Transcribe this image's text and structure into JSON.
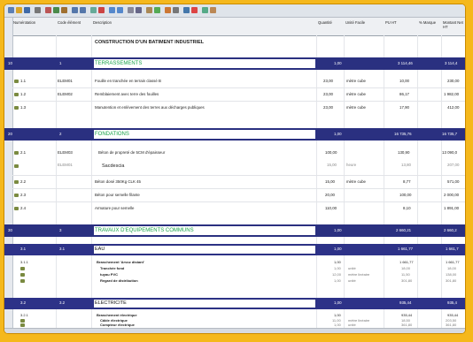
{
  "header": {
    "col_numerotation": "Numérotation",
    "col_code": "Code élément",
    "col_description": "Description",
    "col_quantite": "Quantité",
    "col_unite": "Unité Facile",
    "col_pu": "PU HT",
    "col_pct": "% Marque",
    "col_montant": "Montant Net HT"
  },
  "title_row": {
    "text": "CONSTRUCTION D'UN BATIMENT INDUSTRIEL"
  },
  "sections": [
    {
      "num": "10",
      "code": "1",
      "title": "TERRASSEMENTS",
      "qty": "1,00",
      "pu": "3 114,46",
      "montant": "3 114,4"
    },
    {
      "num": "20",
      "code": "2",
      "title": "FONDATIONS",
      "qty": "1,00",
      "pu": "16 735,76",
      "montant": "16 735,7"
    },
    {
      "num": "30",
      "code": "3",
      "title": "TRAVAUX D'EQUIPEMENTS COMMUNS",
      "qty": "1,00",
      "pu": "2 660,21",
      "montant": "2 660,2"
    }
  ],
  "items_terrassements": [
    {
      "num": "1.1",
      "code": "ELEM01",
      "desc": "Fouille en tranchée en terrain classé B",
      "qty": "23,00",
      "unit": "mètre cube",
      "pu": "10,00",
      "montant": "230,00"
    },
    {
      "num": "1.2",
      "code": "ELEM02",
      "desc": "Remblaiement avec terre des fouilles",
      "qty": "23,00",
      "unit": "mètre cube",
      "pu": "86,17",
      "montant": "1 982,00"
    },
    {
      "num": "1.3",
      "code": "",
      "desc": "Manutention et enlèvement des terres aux décharges publiques",
      "qty": "23,00",
      "unit": "mètre cube",
      "pu": "17,90",
      "montant": "412,00"
    }
  ],
  "items_fondations": [
    {
      "num": "2.1",
      "code": "ELEM03",
      "desc": "Béton de propreté de 5CM d'épaisseur",
      "qty": "100,00",
      "unit": "",
      "pu": "130,90",
      "montant": "13 090,0"
    },
    {
      "num": "",
      "code": "ELEM01",
      "desc": "Sacdescia",
      "qty": "15,00",
      "unit": "heure",
      "pu": "13,80",
      "montant": "207,00"
    },
    {
      "num": "2.2",
      "code": "",
      "desc": "Béton dosé 350Kg CLK 45",
      "qty": "15,00",
      "unit": "mètre cube",
      "pu": "8,77",
      "montant": "571,00"
    },
    {
      "num": "2.3",
      "code": "",
      "desc": "Béton pour semelle filante",
      "qty": "20,00",
      "unit": "",
      "pu": "100,00",
      "montant": "2 000,00"
    },
    {
      "num": "2.4",
      "code": "",
      "desc": "Armature pour semelle",
      "qty": "110,00",
      "unit": "",
      "pu": "8,10",
      "montant": "1 891,00"
    }
  ],
  "sub_eau": {
    "num": "3.1",
    "code": "3.1",
    "title": "EAU",
    "qty": "1,00",
    "pu": "1 661,77",
    "montant": "1 661,7"
  },
  "items_eau": [
    {
      "num": "3.1.1",
      "desc": "Branchement 'Arvoz distant'",
      "qty": "1,00",
      "unit": "",
      "pu": "1 661,77",
      "montant": "1 661,77"
    },
    {
      "num": "",
      "desc": "Tranchée fond",
      "qty": "1,00",
      "unit": "unité",
      "pu": "18,00",
      "montant": "18,00"
    },
    {
      "num": "",
      "desc": "tuyau PVC",
      "qty": "12,00",
      "unit": "mètre linéaire",
      "pu": "11,50",
      "montant": "138,00"
    },
    {
      "num": "",
      "desc": "Regard de distribution",
      "qty": "1,00",
      "unit": "unité",
      "pu": "301,80",
      "montant": "301,80"
    }
  ],
  "sub_elec": {
    "num": "3.2",
    "code": "3.2",
    "title": "ELECTRICITE",
    "qty": "1,00",
    "pu": "935,44",
    "montant": "935,4"
  },
  "items_elec": [
    {
      "num": "3.2.1",
      "desc": "Branchement électrique",
      "qty": "1,00",
      "unit": "",
      "pu": "935,44",
      "montant": "935,44"
    },
    {
      "num": "",
      "desc": "Câble électrique",
      "qty": "11,00",
      "unit": "mètre linéaire",
      "pu": "18,50",
      "montant": "203,50"
    },
    {
      "num": "",
      "desc": "Compteur électrique",
      "qty": "1,00",
      "unit": "unité",
      "pu": "361,80",
      "montant": "361,80"
    }
  ]
}
